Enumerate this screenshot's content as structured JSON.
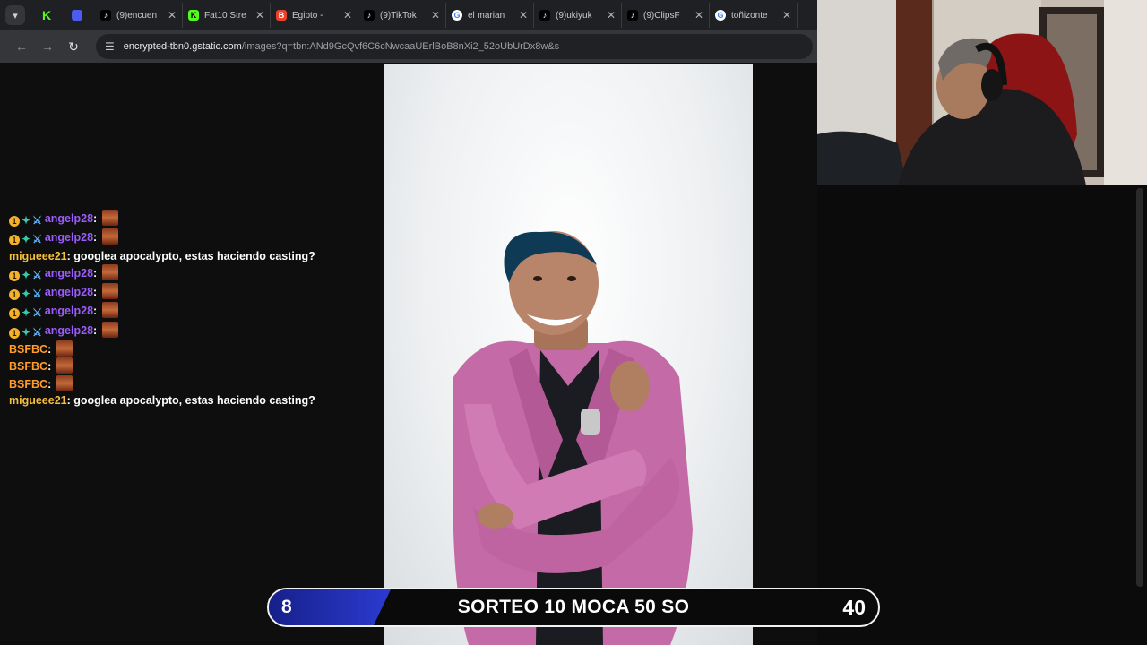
{
  "browser": {
    "tabs": [
      {
        "title": "(9)encuen",
        "icon": "tiktok-icon",
        "color": "#000000"
      },
      {
        "title": "Fat10 Stre",
        "icon": "kick-icon",
        "color": "#53fc18"
      },
      {
        "title": "Egipto -",
        "icon": "blogger-icon",
        "color": "#e8412c"
      },
      {
        "title": "(9)TikTok",
        "icon": "tiktok-icon",
        "color": "#000000"
      },
      {
        "title": "el marian",
        "icon": "google-icon",
        "color": "#4285f4"
      },
      {
        "title": "(9)ukiyuk",
        "icon": "tiktok-icon",
        "color": "#000000"
      },
      {
        "title": "(9)ClipsF",
        "icon": "tiktok-icon",
        "color": "#000000"
      },
      {
        "title": "toñizonte",
        "icon": "google-icon",
        "color": "#4285f4"
      }
    ],
    "url_host": "encrypted-tbn0.gstatic.com",
    "url_rest": "/images?q=tbn:ANd9GcQvf6C6cNwcaaUErlBoB8nXi2_52oUbUrDx8w&s"
  },
  "chat": [
    {
      "badges": true,
      "user": "angelp28",
      "color": "purple",
      "text": "",
      "emote": true
    },
    {
      "badges": true,
      "user": "angelp28",
      "color": "purple",
      "text": "",
      "emote": true
    },
    {
      "badges": false,
      "user": "migueee21",
      "color": "gold",
      "text": "googlea apocalypto, estas haciendo casting?",
      "emote": false
    },
    {
      "badges": true,
      "user": "angelp28",
      "color": "purple",
      "text": "",
      "emote": true
    },
    {
      "badges": true,
      "user": "angelp28",
      "color": "purple",
      "text": "",
      "emote": true
    },
    {
      "badges": true,
      "user": "angelp28",
      "color": "purple",
      "text": "",
      "emote": true
    },
    {
      "badges": true,
      "user": "angelp28",
      "color": "purple",
      "text": "",
      "emote": true
    },
    {
      "badges": false,
      "user": "BSFBC",
      "color": "orange",
      "text": "",
      "emote": true
    },
    {
      "badges": false,
      "user": "BSFBC",
      "color": "orange",
      "text": "",
      "emote": true
    },
    {
      "badges": false,
      "user": "BSFBC",
      "color": "orange",
      "text": "",
      "emote": true
    },
    {
      "badges": false,
      "user": "migueee21",
      "color": "gold",
      "text": "googlea apocalypto, estas haciendo casting?",
      "emote": false
    }
  ],
  "banner": {
    "left_value": "8",
    "title": "SORTEO 10 MOCA 50 SO",
    "right_value": "40",
    "progress": 0.2
  }
}
